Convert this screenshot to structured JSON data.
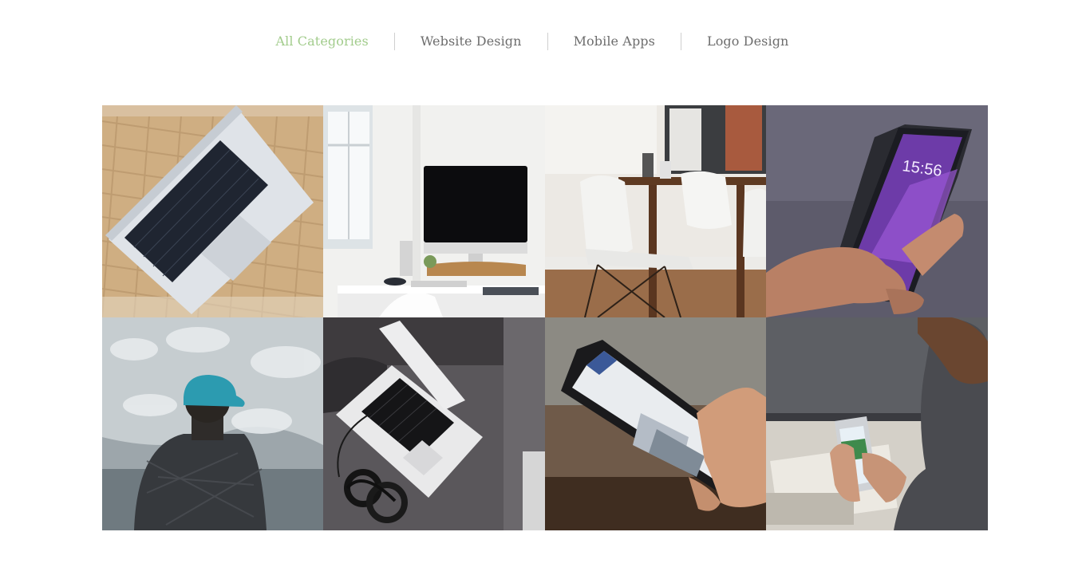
{
  "filters": {
    "all": "All Categories",
    "website": "Website Design",
    "mobile": "Mobile Apps",
    "logo": "Logo Design"
  },
  "colors": {
    "accent": "#a2cc8c",
    "filter_text": "#6d6d6d",
    "divider": "#cfcfcf"
  },
  "gallery": [
    {
      "subject": "laptop-on-wicker-tray"
    },
    {
      "subject": "imac-desk-workspace"
    },
    {
      "subject": "white-chairs-dining-table"
    },
    {
      "subject": "hand-holding-iphone"
    },
    {
      "subject": "man-blue-cap-mountains"
    },
    {
      "subject": "laptop-headphones-gray"
    },
    {
      "subject": "hand-holding-phone-app"
    },
    {
      "subject": "woman-holding-phone-map"
    }
  ]
}
